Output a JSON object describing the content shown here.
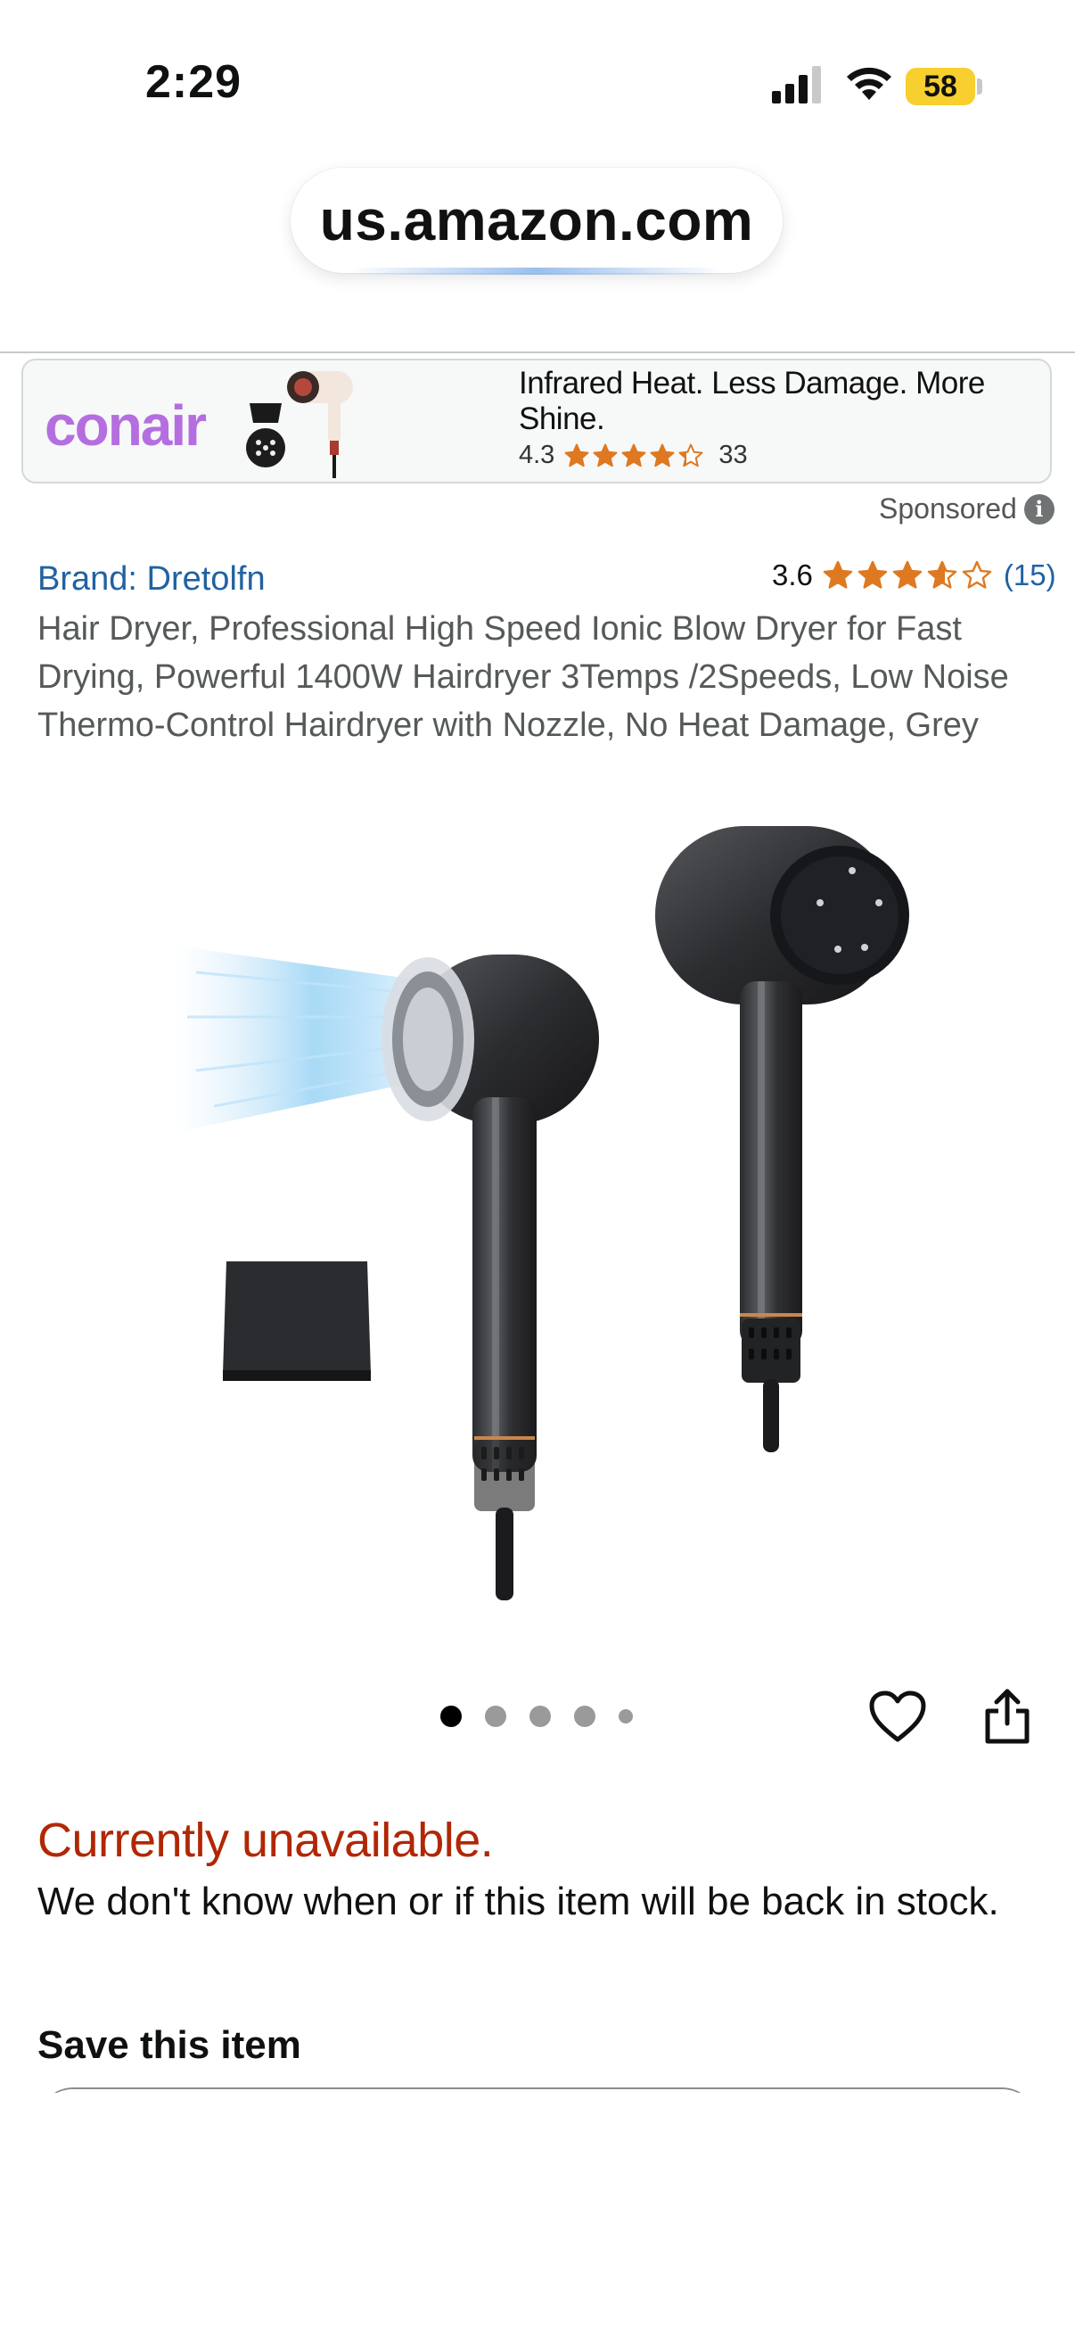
{
  "status_bar": {
    "time": "2:29",
    "battery": "58"
  },
  "browser": {
    "url": "us.amazon.com"
  },
  "ad": {
    "logo_text": "conair",
    "headline": "Infrared Heat. Less Damage. More Shine.",
    "rating": "4.3",
    "rating_stars": 4.3,
    "review_count": "33",
    "sponsored_label": "Sponsored"
  },
  "product": {
    "brand_link": "Brand: Dretolfn",
    "rating": "3.6",
    "rating_stars": 3.6,
    "review_count": "(15)",
    "title": "Hair Dryer, Professional High Speed Ionic Blow Dryer for Fast Drying, Powerful 1400W Hairdryer 3Temps /2Speeds, Low Noise Thermo-Control Hairdryer with Nozzle, No Heat Damage, Grey",
    "image_count": 5,
    "active_image": 1
  },
  "availability": {
    "status": "Currently unavailable.",
    "message": "We don't know when or if this item will be back in stock."
  },
  "save": {
    "heading": "Save this item"
  },
  "colors": {
    "link": "#2162a1",
    "unavailable": "#b12704",
    "star": "#de7921",
    "ad_logo": "#b46ee0",
    "battery": "#f7cf2e"
  },
  "icons": {
    "signal": "cellular-signal-icon",
    "wifi": "wifi-icon",
    "info": "info-icon",
    "wishlist": "heart-icon",
    "share": "share-icon"
  }
}
